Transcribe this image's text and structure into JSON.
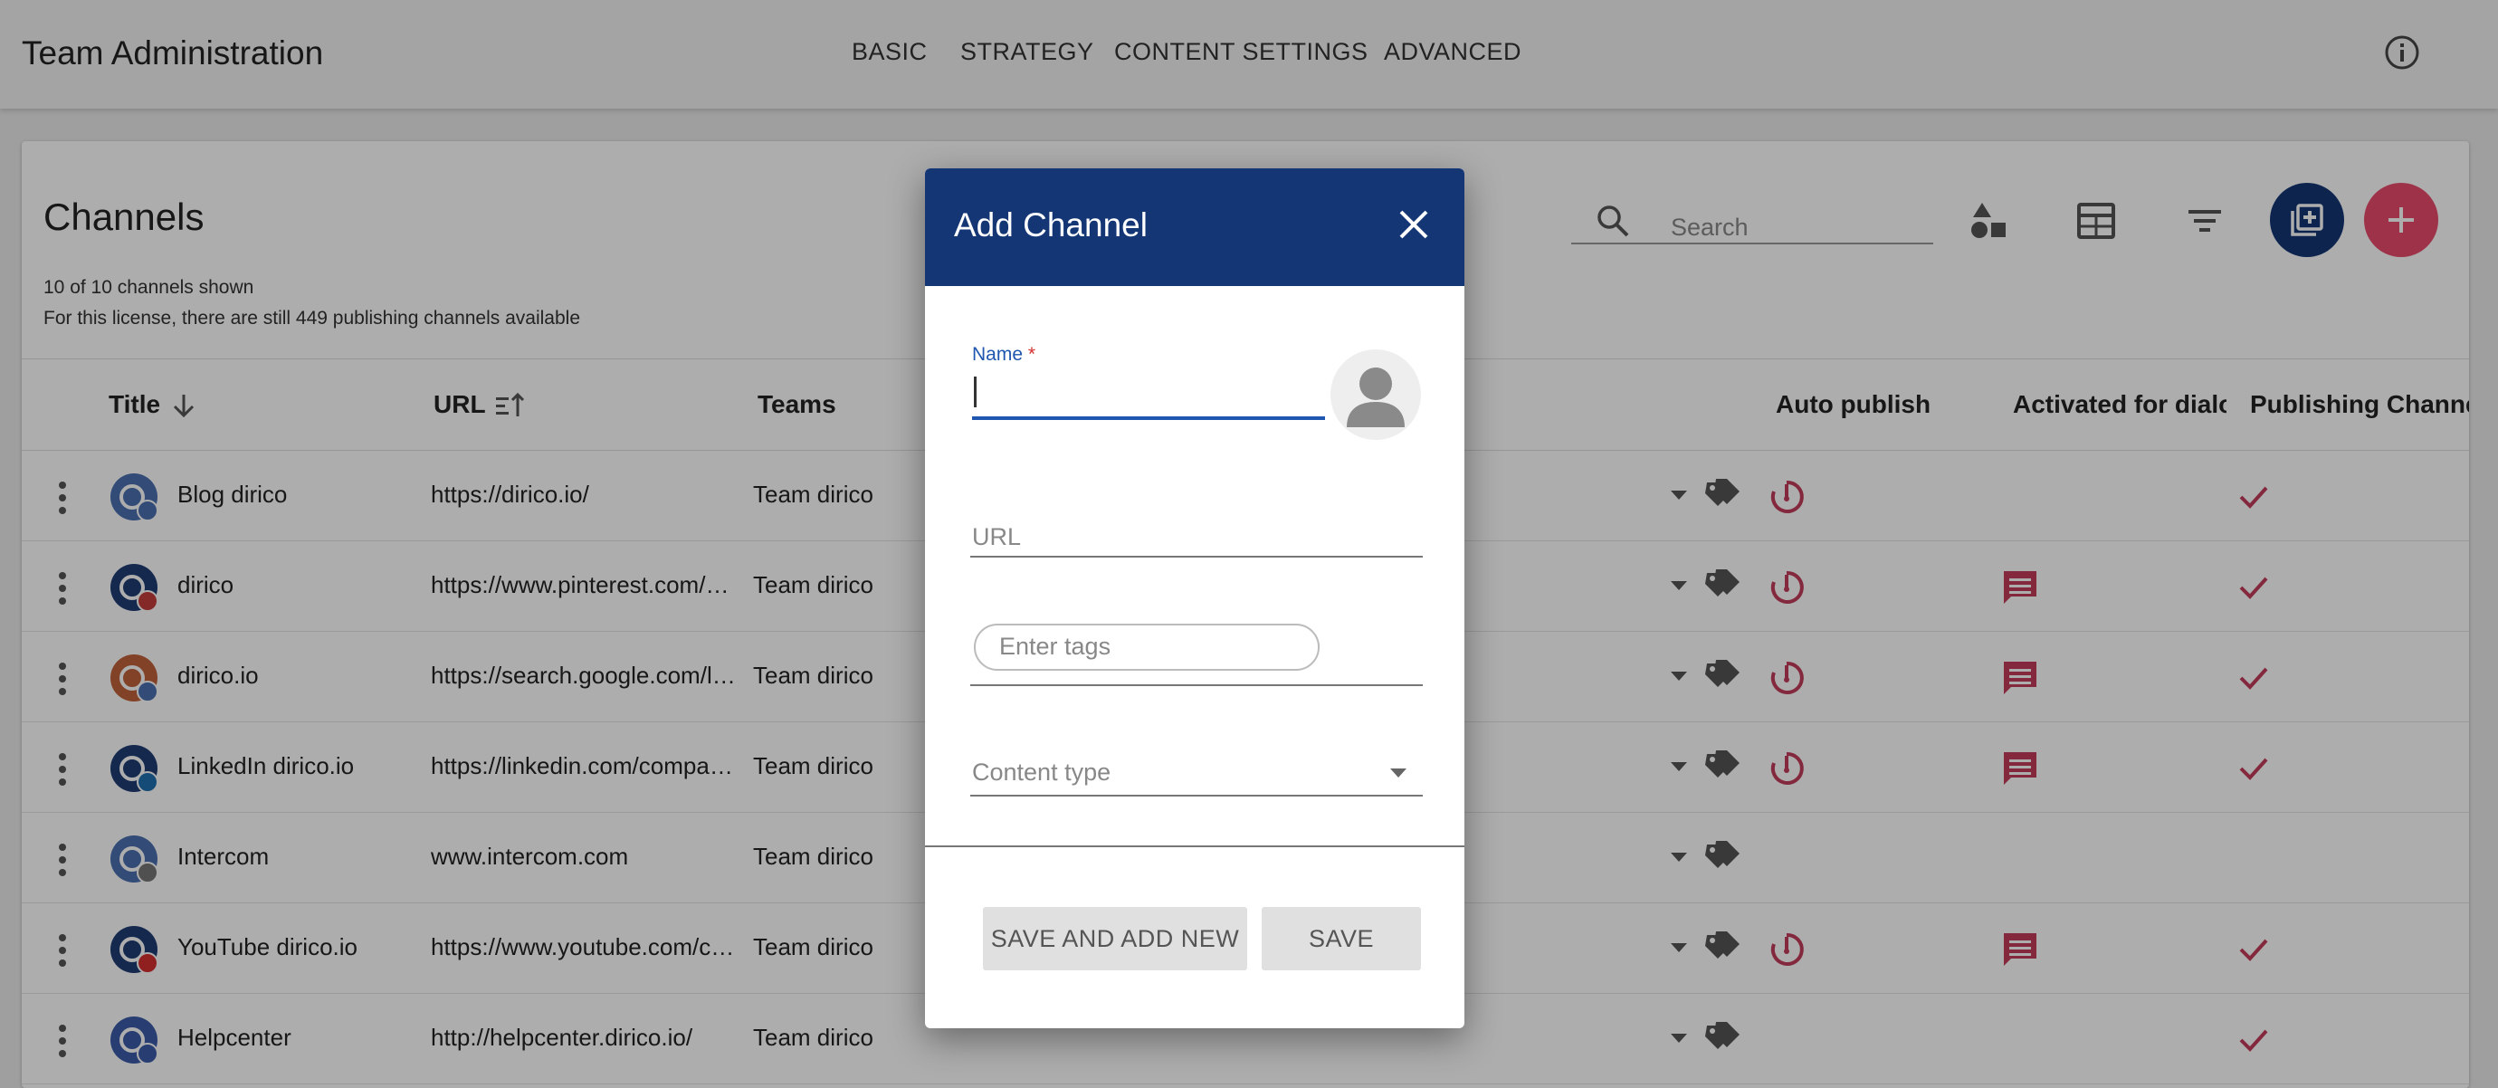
{
  "app": {
    "title": "Team Administration",
    "nav": [
      "BASIC",
      "STRATEGY",
      "CONTENT SETTINGS",
      "ADVANCED"
    ]
  },
  "channels": {
    "title": "Channels",
    "shown": "10 of 10 channels shown",
    "license_note": "For this license, there are still 449 publishing channels available",
    "search_placeholder": "Search",
    "columns": {
      "title": "Title",
      "url": "URL",
      "teams": "Teams",
      "auto_publish": "Auto publish",
      "dialog": "Activated for dialog",
      "publishing": "Publishing Channel"
    },
    "rows": [
      {
        "name": "Blog dirico",
        "url": "https://dirico.io/",
        "team": "Team dirico",
        "icon": "blog-icon",
        "auto": true,
        "dialog": false,
        "publishing": true
      },
      {
        "name": "dirico",
        "url": "https://www.pinterest.com/dirico",
        "team": "Team dirico",
        "icon": "pinterest-icon",
        "auto": true,
        "dialog": true,
        "publishing": true
      },
      {
        "name": "dirico.io",
        "url": "https://search.google.com/local",
        "team": "Team dirico",
        "icon": "google-icon",
        "auto": true,
        "dialog": true,
        "publishing": true
      },
      {
        "name": "LinkedIn dirico.io",
        "url": "https://linkedin.com/company/dirico",
        "team": "Team dirico",
        "icon": "linkedin-icon",
        "auto": true,
        "dialog": true,
        "publishing": true
      },
      {
        "name": "Intercom",
        "url": "www.intercom.com",
        "team": "Team dirico",
        "icon": "intercom-icon",
        "auto": false,
        "dialog": false,
        "publishing": false
      },
      {
        "name": "YouTube dirico.io",
        "url": "https://www.youtube.com/channel",
        "team": "Team dirico",
        "icon": "youtube-icon",
        "auto": true,
        "dialog": true,
        "publishing": true
      },
      {
        "name": "Helpcenter",
        "url": "http://helpcenter.dirico.io/",
        "team": "Team dirico",
        "icon": "helpcenter-icon",
        "auto": false,
        "dialog": false,
        "publishing": true
      }
    ]
  },
  "dialog": {
    "title": "Add Channel",
    "name_label": "Name",
    "required_mark": "*",
    "url_placeholder": "URL",
    "tags_placeholder": "Enter tags",
    "content_type_placeholder": "Content type",
    "save_add_label": "SAVE AND ADD NEW",
    "save_label": "SAVE"
  },
  "colors": {
    "primary": "#143674",
    "accent": "#c33b5a",
    "fab_red": "#e84a6a"
  }
}
